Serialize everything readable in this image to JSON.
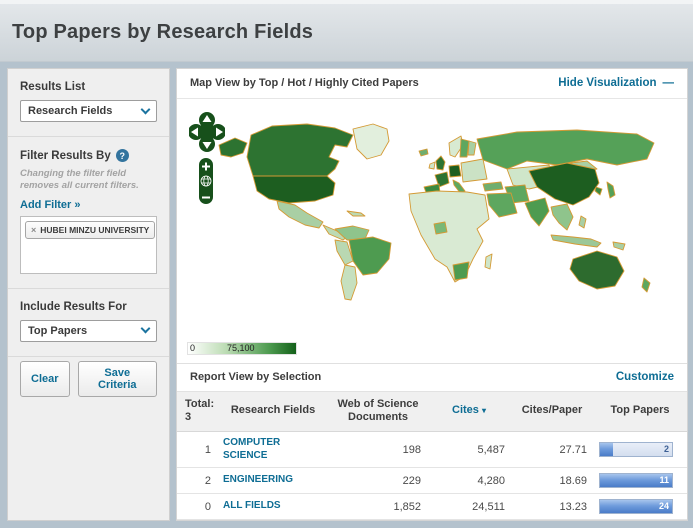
{
  "page": {
    "title": "Top Papers by Research Fields"
  },
  "sidebar": {
    "results_list_label": "Results List",
    "results_list_value": "Research Fields",
    "filter_by_label": "Filter Results By",
    "filter_note": "Changing the filter field removes all current filters.",
    "add_filter_label": "Add Filter »",
    "filter_tags": [
      {
        "label": "HUBEI MINZU UNIVERSITY"
      }
    ],
    "include_results_label": "Include Results For",
    "include_results_value": "Top Papers",
    "clear_button": "Clear",
    "save_button": "Save Criteria"
  },
  "icons": {
    "help": "?",
    "remove_tag": "×",
    "hide_minus": "—",
    "sort_desc": "▾"
  },
  "map": {
    "header": "Map View by Top / Hot / Highly Cited Papers",
    "hide_link": "Hide Visualization",
    "legend": {
      "min": "0",
      "max": "75,100"
    },
    "border_color": "#d49a35",
    "colors": {
      "alaska": "#2d7331",
      "canada": "#2d7331",
      "usa": "#1d5e20",
      "greenland": "#e2efdd",
      "mexico": "#a9cfa4",
      "central_america": "#bcdab4",
      "caribbean": "#bcdab4",
      "colombia": "#8fc48c",
      "brazil": "#4e9b50",
      "peru": "#b9d8b2",
      "argentina": "#c6e0bf",
      "iceland": "#6fae6f",
      "uk": "#2d7331",
      "ireland": "#cfe6ca",
      "norway": "#d8ead2",
      "sweden": "#5ea75f",
      "finland": "#a9cfa4",
      "france": "#2d7331",
      "germany": "#1d5e20",
      "spain": "#3c8a3f",
      "italy": "#5ea75f",
      "east_europe": "#cbe2c5",
      "russia": "#55a158",
      "central_asia": "#cfe6ca",
      "mongolia": "#a9cfa4",
      "turkey": "#6fae6f",
      "iran": "#5ea75f",
      "saudi": "#5ea75f",
      "africa": "#d9ead3",
      "nigeria": "#7ab877",
      "south_africa": "#4e9b50",
      "madagascar": "#cfe6ca",
      "india": "#4e9b50",
      "china": "#1d5e20",
      "korea": "#3c8a3f",
      "japan": "#55a158",
      "se_asia": "#8fc48c",
      "philippines": "#a9cfa4",
      "indonesia": "#9cc898",
      "png": "#a9cfa4",
      "australia": "#2d6b2e",
      "new_zealand": "#5ea75f"
    }
  },
  "report": {
    "header": "Report View by Selection",
    "customize_link": "Customize",
    "total_label": "Total: 3",
    "columns": {
      "field": "Research Fields",
      "documents": "Web of Science Documents",
      "cites": "Cites",
      "cites_per_paper": "Cites/Paper",
      "top_papers": "Top Papers"
    },
    "rows": [
      {
        "rank": "1",
        "field": "COMPUTER SCIENCE",
        "documents": "198",
        "cites": "5,487",
        "cites_per_paper": "27.71",
        "top_papers": "2",
        "bar_width": "18%"
      },
      {
        "rank": "2",
        "field": "ENGINEERING",
        "documents": "229",
        "cites": "4,280",
        "cites_per_paper": "18.69",
        "top_papers": "11",
        "bar_width": "100%"
      },
      {
        "rank": "0",
        "field": "ALL FIELDS",
        "documents": "1,852",
        "cites": "24,511",
        "cites_per_paper": "13.23",
        "top_papers": "24",
        "bar_width": "100%"
      }
    ]
  }
}
